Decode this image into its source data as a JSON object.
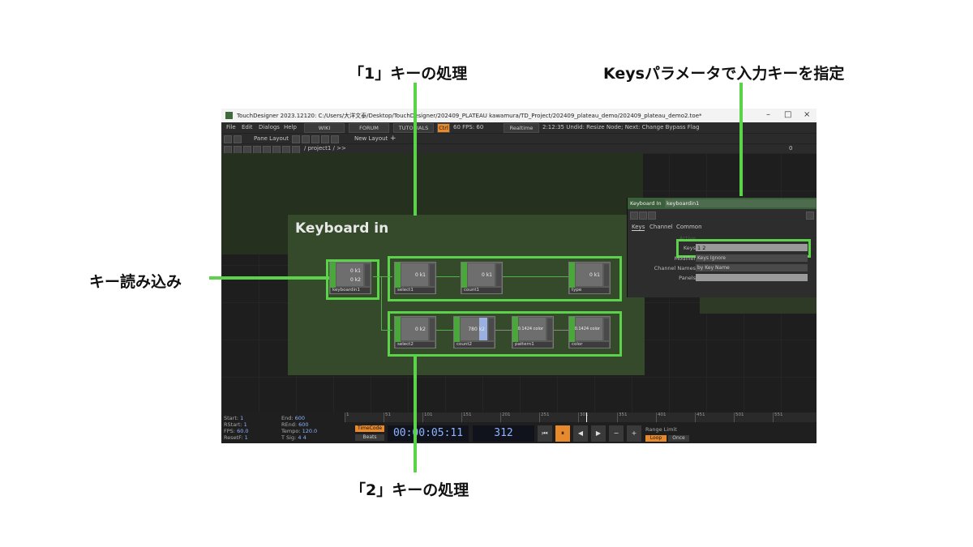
{
  "annotations": {
    "process1": "「1」キーの処理",
    "keys_param": "Keysパラメータで入力キーを指定",
    "key_read": "キー読み込み",
    "process2": "「2」キーの処理"
  },
  "window": {
    "title": "TouchDesigner 2023.12120: C:/Users/大洋文泰/Desktop/TouchDesigner/202409_PLATEAU kawamura/TD_Project/202409_plateau_demo/202409_plateau_demo2.toe*",
    "controls": [
      "–",
      "□",
      "×"
    ]
  },
  "menubar": {
    "items": [
      "File",
      "Edit",
      "Dialogs",
      "Help"
    ],
    "buttons": [
      "WIKI",
      "FORUM",
      "TUTORIALS"
    ],
    "ctrl": "Ctrl",
    "fps_label": "60  FPS:  60",
    "realtime": "Realtime",
    "status": "2:12:35 Undid: Resize Node; Next: Change Bypass Flag"
  },
  "toolbar": {
    "pane_layout": "Pane Layout",
    "new_layout": "New Layout",
    "plus": "+",
    "path": "/ project1 / >>",
    "right_num": "0"
  },
  "network": {
    "box_title": "Keyboard in",
    "nodes": {
      "keyboard": {
        "name": "keyboardin1",
        "val1": "0 k1",
        "val2": "0 k2"
      },
      "select1": {
        "name": "select1",
        "val": "0 k1"
      },
      "count1": {
        "name": "count1",
        "val": "0 k1"
      },
      "type": {
        "name": "type",
        "val": "0 k1"
      },
      "select2": {
        "name": "select2",
        "val": "0 k2"
      },
      "count2": {
        "name": "count2",
        "val": "780 k2"
      },
      "pattern1": {
        "name": "pattern1",
        "val": "0.1424 color"
      },
      "color": {
        "name": "color",
        "val": "0.1424 color"
      },
      "ramp5": {
        "name": "ramp5"
      }
    }
  },
  "param_panel": {
    "op_type": "Keyboard In",
    "op_name": "keyboardin1",
    "tabs": [
      "Keys",
      "Channel",
      "Common"
    ],
    "keys_label": "Keys",
    "keys_value": "1 2",
    "modifier_label": "Modifier",
    "modifier_value": "Keys Ignore",
    "channel_names_label": "Channel Names",
    "channel_names_value": "by Key Name",
    "panels_label": "Panels",
    "active_label": "Active"
  },
  "timeline": {
    "start_label": "Start:",
    "start": "1",
    "end_label": "End:",
    "end": "600",
    "rstart_label": "RStart:",
    "rstart": "1",
    "rend_label": "REnd:",
    "rend": "600",
    "fps_label": "FPS:",
    "fps": "60.0",
    "tempo_label": "Tempo:",
    "tempo": "120.0",
    "resetf_label": "ResetF:",
    "resetf": "1",
    "tsig_label": "T Sig:",
    "tsig": "4    4",
    "ticks": [
      "1",
      "51",
      "101",
      "151",
      "201",
      "251",
      "301",
      "351",
      "401",
      "451",
      "501",
      "551"
    ],
    "timecode": "TimeCode",
    "beats": "Beats",
    "time": "00:00:05:11",
    "frame": "312",
    "range_limit": "Range Limit",
    "loop": "Loop",
    "once": "Once"
  },
  "colors": {
    "highlight": "#5bd24a",
    "accent": "#e8892b",
    "node_flag": "#4aa83a"
  }
}
